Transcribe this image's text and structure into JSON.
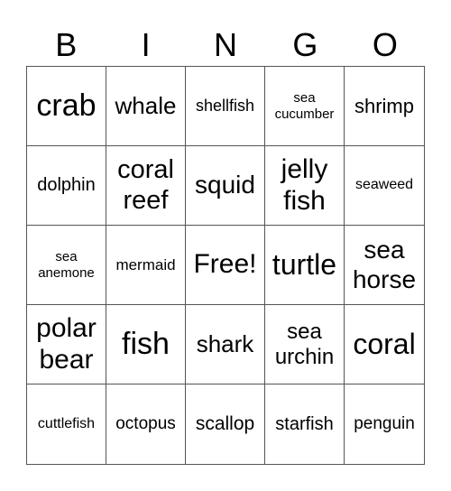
{
  "header": [
    "B",
    "I",
    "N",
    "G",
    "O"
  ],
  "cells": [
    "crab",
    "whale",
    "shellfish",
    "sea cucumber",
    "shrimp",
    "dolphin",
    "coral reef",
    "squid",
    "jelly fish",
    "seaweed",
    "sea anemone",
    "mermaid",
    "Free!",
    "turtle",
    "sea horse",
    "polar bear",
    "fish",
    "shark",
    "sea urchin",
    "coral",
    "cuttlefish",
    "octopus",
    "scallop",
    "starfish",
    "penguin"
  ]
}
